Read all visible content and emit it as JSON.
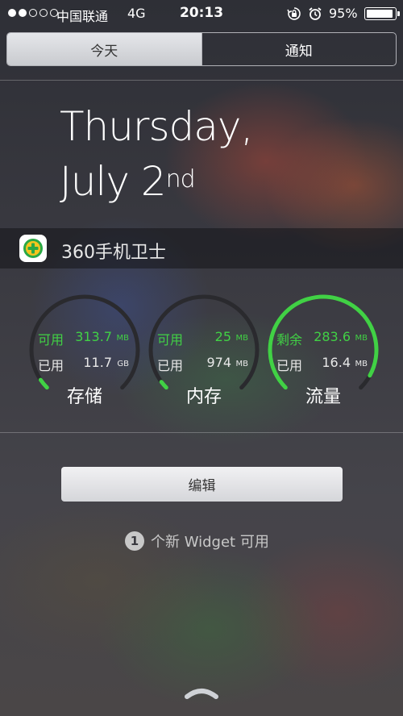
{
  "status_bar": {
    "signal_dots": [
      true,
      true,
      false,
      false,
      false
    ],
    "carrier": "中国联通",
    "network": "4G",
    "time": "20:13",
    "battery_percent": "95%",
    "battery_level": 0.95,
    "icons": [
      "rotation-lock-icon",
      "alarm-icon",
      "battery-icon"
    ]
  },
  "tabs": [
    {
      "label": "今天",
      "active": true
    },
    {
      "label": "通知",
      "active": false
    }
  ],
  "date": {
    "line1": "Thursday,",
    "line2": "July 2",
    "suffix": "nd"
  },
  "widget": {
    "title": "360手机卫士",
    "icon": "360-guard-icon",
    "gauges": [
      {
        "name": "存储",
        "row1_label": "可用",
        "row1_value": "313.7",
        "row1_unit": "MB",
        "row2_label": "已用",
        "row2_value": "11.7",
        "row2_unit": "GB",
        "level": 0.04
      },
      {
        "name": "内存",
        "row1_label": "可用",
        "row1_value": "25",
        "row1_unit": "MB",
        "row2_label": "已用",
        "row2_value": "974",
        "row2_unit": "MB",
        "level": 0.03
      },
      {
        "name": "流量",
        "row1_label": "剩余",
        "row1_value": "283.6",
        "row1_unit": "MB",
        "row2_label": "已用",
        "row2_value": "16.4",
        "row2_unit": "MB",
        "level": 0.94
      }
    ]
  },
  "edit_button": "编辑",
  "new_widgets": {
    "count": "1",
    "text": "个新 Widget 可用"
  },
  "colors": {
    "accent_green": "#41d145",
    "track": "#2a2a2e"
  }
}
